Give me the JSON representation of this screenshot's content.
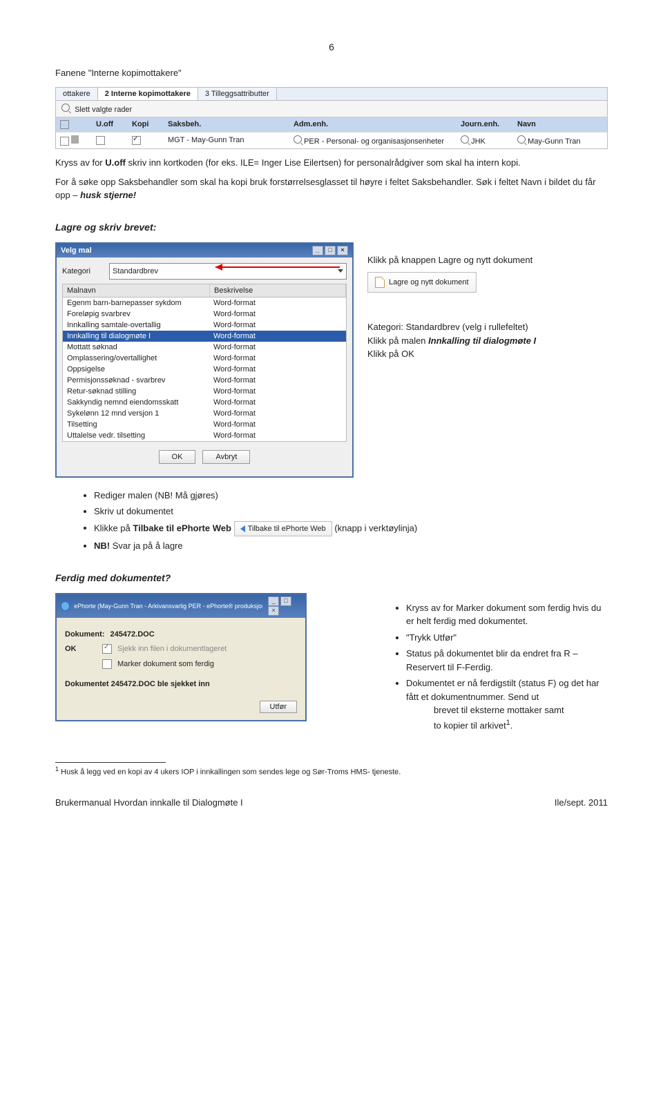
{
  "page_number": "6",
  "heading1": "Fanene \"Interne kopimottakere\"",
  "tabs_shot": {
    "tab1": "ottakere",
    "tab2": "2 Interne kopimottakere",
    "tab3": "3 Tilleggsattributter",
    "slett": "Slett valgte rader",
    "h_uoff": "U.off",
    "h_kopi": "Kopi",
    "h_saks": "Saksbeh.",
    "h_adm": "Adm.enh.",
    "h_journ": "Journ.enh.",
    "h_navn": "Navn",
    "row_saks": "MGT - May-Gunn Tran",
    "row_adm": "PER - Personal- og organisasjonsenheter",
    "row_journ": "JHK",
    "row_navn": "May-Gunn Tran"
  },
  "p1_a": "Kryss av for ",
  "p1_b": "U.off",
  "p1_c": " skriv inn kortkoden (for eks. ILE= Inger Lise Eilertsen) for personalrådgiver som skal ha intern kopi.",
  "p2_a": "For å søke opp Saksbehandler som skal ha kopi bruk forstørrelsesglasset til høyre i feltet Saksbehandler. Søk i feltet Navn i bildet du får opp – ",
  "p2_b": "husk stjerne!",
  "heading2": "Lagre og skriv brevet:",
  "velg_mal": {
    "title": "Velg mal",
    "lbl_kategori": "Kategori",
    "kategori_val": "Standardbrev",
    "col_malnavn": "Malnavn",
    "col_beskrivelse": "Beskrivelse",
    "rows": [
      "Egenm barn-barnepasser sykdom",
      "Foreløpig svarbrev",
      "Innkalling samtale-overtallig",
      "Innkalling til dialogmøte I",
      "Mottatt søknad",
      "Omplassering/overtallighet",
      "Oppsigelse",
      "Permisjonssøknad - svarbrev",
      "Retur-søknad stilling",
      "Sakkyndig nemnd eiendomsskatt",
      "Sykelønn 12 mnd versjon 1",
      "Tilsetting",
      "Uttalelse vedr. tilsetting"
    ],
    "desc": "Word-format",
    "ok": "OK",
    "avbryt": "Avbryt"
  },
  "right_1": "Klikk på knappen Lagre og nytt dokument",
  "lagre_btn": "Lagre og nytt dokument",
  "right_2a": "Kategori: Standardbrev (velg i rullefeltet)",
  "right_2b": "Klikk på malen ",
  "right_2c": "Innkalling til dialogmøte I",
  "right_2d": "Klikk på OK",
  "bullets1": {
    "b1": "Rediger malen (NB! Må gjøres)",
    "b2": "Skriv ut dokumentet",
    "b3a": "Klikke på ",
    "b3b": "Tilbake til ePhorte Web",
    "b3_btn": "Tilbake til ePhorte Web",
    "b3c": " (knapp i verktøylinja)",
    "b4a": "NB!",
    "b4b": " Svar ja på å lagre"
  },
  "heading3": "Ferdig med dokumentet?",
  "ferdig_dlg": {
    "title": "ePhorte (May-Gunn Tran - Arkivansvarlig PER - ePhorte® produksjon) - ...",
    "dok_lbl": "Dokument:",
    "dok_val": "245472.DOC",
    "ok_lbl": "OK",
    "chk1": "Sjekk inn filen i dokumentlageret",
    "chk2": "Marker dokument som ferdig",
    "sjekket": "Dokumentet 245472.DOC ble sjekket inn",
    "utfor": "Utfør"
  },
  "bullets2": {
    "b1a": "Kryss av for Marker dokument som ferdig hvis du er helt ferdig med dokumentet.",
    "b2": "\"Trykk Utfør\"",
    "b3": "Status på dokumentet blir da endret fra R – Reservert til F-Ferdig.",
    "b4": "Dokumentet er nå ferdigstilt (status F) og det har fått et dokumentnummer. Send ut",
    "indent1": "brevet til eksterne mottaker samt",
    "indent2": "to kopier til arkivet",
    "sup": "1",
    "dot": "."
  },
  "footnote": "Husk å legg ved en kopi av 4 ukers IOP i innkallingen som sendes lege og Sør-Troms HMS- tjeneste.",
  "footnote_num": "1",
  "footer_left": "Brukermanual Hvordan innkalle til Dialogmøte I",
  "footer_right": "Ile/sept. 2011"
}
